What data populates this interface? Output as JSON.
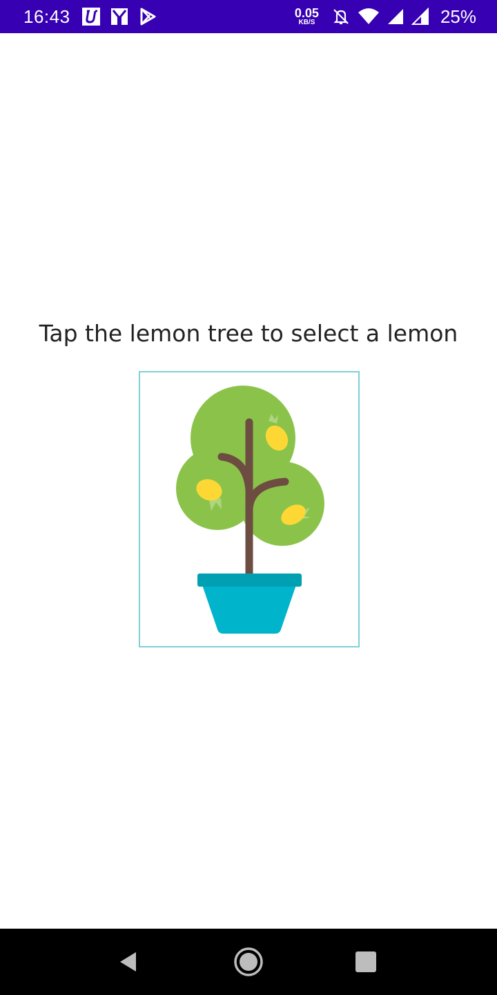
{
  "status_bar": {
    "time": "16:43",
    "left_icons": [
      "u-app-icon",
      "m-app-icon",
      "play-store-icon"
    ],
    "net_speed": {
      "value": "0.05",
      "unit": "KB/S"
    },
    "right_icons": [
      "notifications-off-icon",
      "wifi-icon",
      "signal-icon",
      "signal-icon-2"
    ],
    "battery_percent": "25%"
  },
  "main": {
    "instruction": "Tap the lemon tree to select a lemon",
    "image": {
      "icon": "lemon-tree-icon",
      "colors": {
        "foliage": "#8bc34a",
        "trunk": "#6d4c41",
        "lemon": "#fdd835",
        "leaf": "#aed581",
        "pot": "#00b4cc",
        "pot_rim": "#00a0b2",
        "border": "#7fcfd6"
      }
    }
  },
  "nav_bar": {
    "buttons": [
      "back-icon",
      "home-icon",
      "recents-icon"
    ]
  }
}
